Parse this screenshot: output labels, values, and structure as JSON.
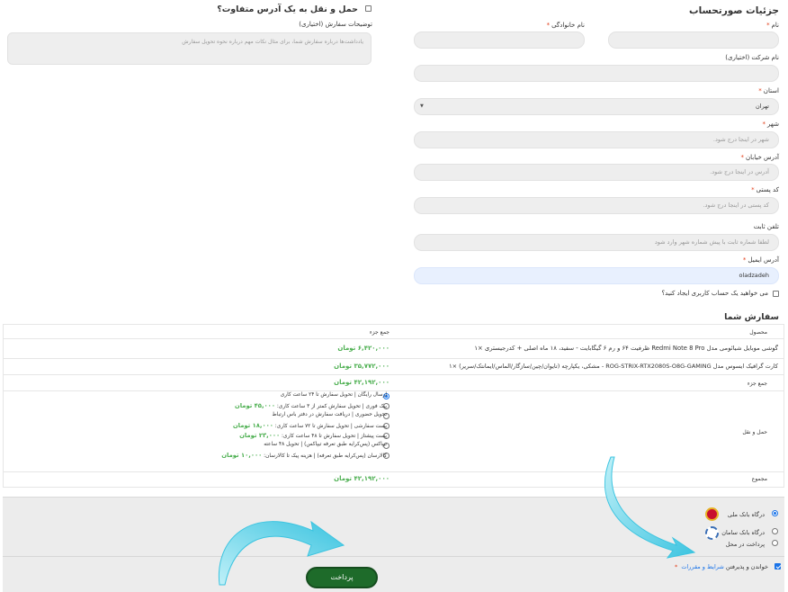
{
  "billing": {
    "title": "جزئیات صورتحساب",
    "first_name_label": "نام",
    "last_name_label": "نام خانوادگی",
    "company_label": "نام شرکت (اختیاری)",
    "state_label": "استان",
    "state_value": "تهران",
    "city_label": "شهر",
    "city_placeholder": "شهر در اینجا درج شود.",
    "street_label": "آدرس خیابان",
    "street_placeholder": "آدرس در اینجا درج شود.",
    "postcode_label": "کد پستی",
    "postcode_placeholder": "کد پستی در اینجا درج شود.",
    "phone_label": "تلفن ثابت",
    "phone_placeholder": "لطفا شماره ثابت با پیش شماره شهر وارد شود",
    "email_label": "آدرس ایمیل",
    "email_value": "oladzadeh",
    "create_account_label": "می خواهید یک حساب کاربری ایجاد کنید؟",
    "required_mark": "*"
  },
  "shipping": {
    "different_address_label": "حمل و نقل به یک آدرس متفاوت؟",
    "notes_label": "توضیحات سفارش (اختیاری)",
    "notes_placeholder": "یادداشت‌ها درباره سفارش شما، برای مثال نکات مهم درباره نحوه تحویل سفارش"
  },
  "order": {
    "title": "سفارش شما",
    "header_product": "محصول",
    "header_subtotal": "جمع جزء",
    "items": [
      {
        "name": "گوشی موبایل شیائومی مدل Redmi Note 8 Pro ظرفیت ۶۴ و رم ۶ گیگابایت - سفید، ۱۸ ماه اصلی + کدرجیستری ×۱",
        "price": "۶,۴۲۰,۰۰۰ تومان"
      },
      {
        "name": "کارت گرافیک ایسوس مدل ROG-STRIX-RTX2080S-O8G-GAMING - مشکی، یکپارچه (تایوان/چین/سازگار/الماس/ایمانتک/سریر) ×۱",
        "price": "۳۵,۷۷۲,۰۰۰ تومان"
      }
    ],
    "subtotal_label": "جمع جزء",
    "subtotal_value": "۴۲,۱۹۲,۰۰۰ تومان",
    "shipping_label": "حمل و نقل",
    "shipping_options": [
      {
        "text": "ارسال رایگان | تحویل سفارش تا ۲۴ ساعت کاری",
        "price": "",
        "selected": true
      },
      {
        "text": "پیک فوری | تحویل سفارش کمتر از ۳ ساعت کاری:",
        "price": "۴۵,۰۰۰ تومان",
        "selected": false
      },
      {
        "text": "تحویل حضوری | دریافت سفارش در دفتر باس ارتباط",
        "price": "",
        "selected": false
      },
      {
        "text": "پست سفارشی | تحویل سفارش تا ۷۲ ساعت کاری:",
        "price": "۱۸,۰۰۰ تومان",
        "selected": false
      },
      {
        "text": "پست پیشتاز | تحویل سفارش تا ۴۸ ساعت کاری:",
        "price": "۲۳,۰۰۰ تومان",
        "selected": false
      },
      {
        "text": "تیپاکس (پس‌کرایه طبق تعرفه تیپاکس) | تحویل ۴۸ ساعته",
        "price": "",
        "selected": false
      },
      {
        "text": "کالارسان (پس‌کرایه طبق تعرفه) | هزینه پیک تا کالارسان:",
        "price": "۱۰,۰۰۰ تومان",
        "selected": false
      }
    ],
    "total_label": "مجموع",
    "total_value": "۴۲,۱۹۲,۰۰۰ تومان"
  },
  "payment": {
    "methods": [
      {
        "label": "درگاه بانک ملی",
        "selected": true,
        "logo": "bank-melli-logo"
      },
      {
        "label": "درگاه بانک سامان",
        "selected": false,
        "logo": "bank-saman-logo"
      },
      {
        "label": "پرداخت در محل",
        "selected": false,
        "logo": ""
      }
    ],
    "terms_prefix": "خواندن و پذیرفتن",
    "terms_link": "شرایط و مقررات",
    "terms_checked": true,
    "pay_button": "پرداخت"
  },
  "colors": {
    "price_green": "#4caf50",
    "pay_button": "#1e6b2a",
    "annotation_arrow": "#3cc4e0",
    "required": "#e2401c"
  }
}
